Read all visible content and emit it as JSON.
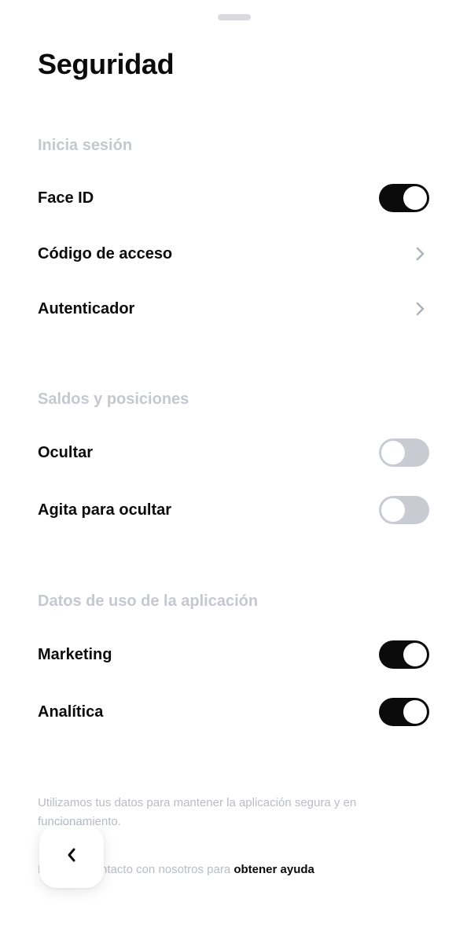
{
  "title": "Seguridad",
  "sections": [
    {
      "header": "Inicia sesión",
      "rows": [
        {
          "label": "Face ID",
          "control": "toggle",
          "on": true
        },
        {
          "label": "Código de acceso",
          "control": "chevron"
        },
        {
          "label": "Autenticador",
          "control": "chevron"
        }
      ]
    },
    {
      "header": "Saldos y posiciones",
      "rows": [
        {
          "label": "Ocultar",
          "control": "toggle",
          "on": false
        },
        {
          "label": "Agita para ocultar",
          "control": "toggle",
          "on": false
        }
      ]
    },
    {
      "header": "Datos de uso de la aplicación",
      "rows": [
        {
          "label": "Marketing",
          "control": "toggle",
          "on": true
        },
        {
          "label": "Analítica",
          "control": "toggle",
          "on": true
        }
      ]
    }
  ],
  "footer": {
    "note": "Utilizamos tus datos para mantener la aplicación segura y en funcionamiento.",
    "help_prefix": "Ponte en contacto con nosotros para ",
    "help_link": "obtener ayuda"
  },
  "icons": {
    "chevron": "chevron-right-icon",
    "back": "chevron-left-icon"
  },
  "colors": {
    "toggle_on": "#0b0b0b",
    "toggle_off": "#c8cbd1",
    "section_header": "#c5c8cf",
    "chevron": "#aeb2ba"
  }
}
